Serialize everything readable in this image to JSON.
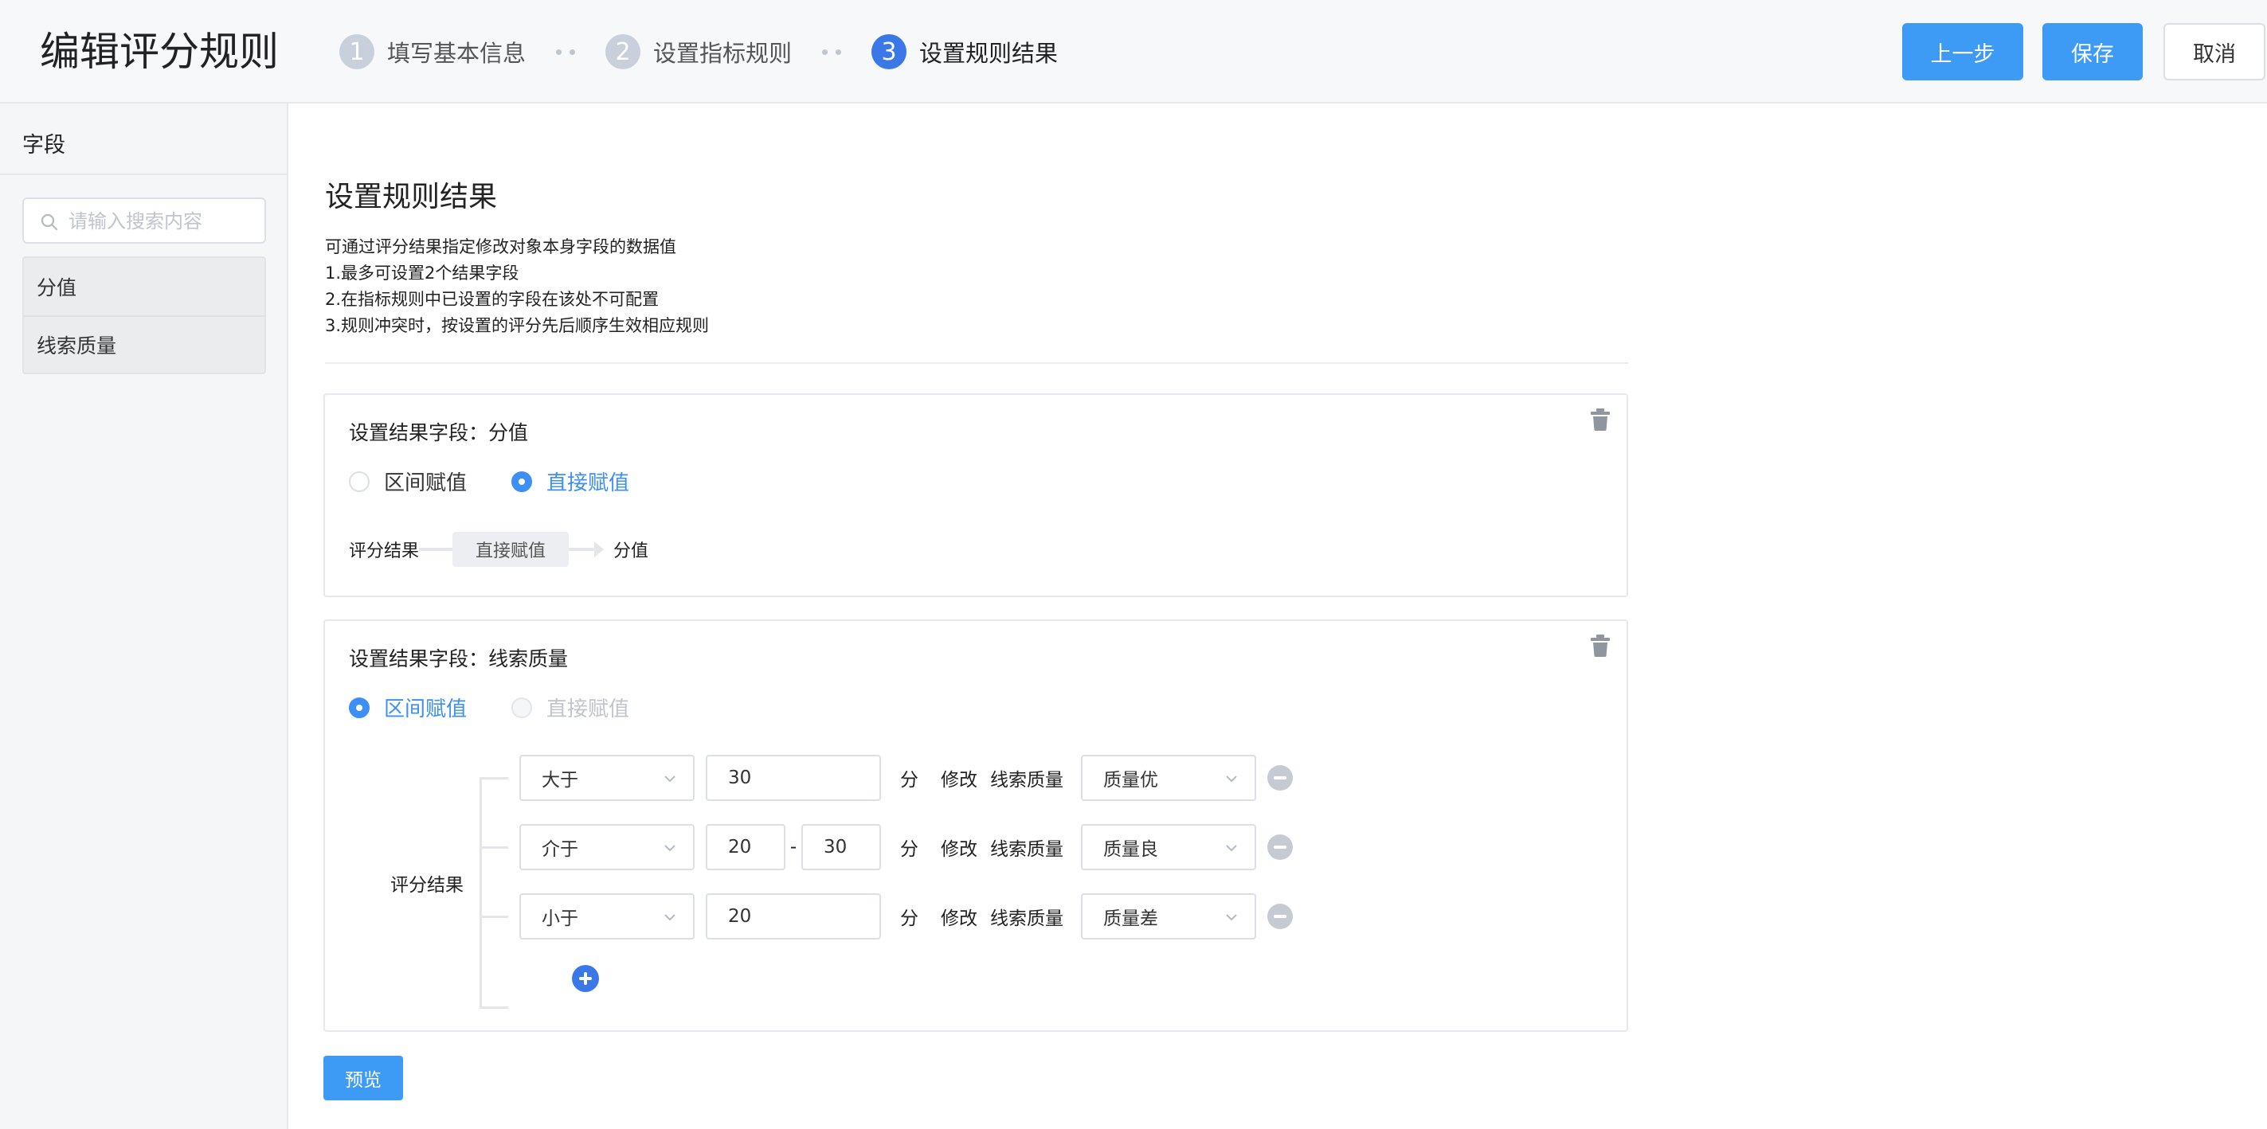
{
  "header": {
    "title": "编辑评分规则",
    "steps": [
      {
        "num": "1",
        "label": "填写基本信息"
      },
      {
        "num": "2",
        "label": "设置指标规则"
      },
      {
        "num": "3",
        "label": "设置规则结果"
      }
    ],
    "prev_label": "上一步",
    "save_label": "保存",
    "cancel_label": "取消"
  },
  "sidebar": {
    "title": "字段",
    "search_placeholder": "请输入搜索内容",
    "items": [
      {
        "label": "分值"
      },
      {
        "label": "线索质量"
      }
    ]
  },
  "main": {
    "title": "设置规则结果",
    "desc": [
      "可通过评分结果指定修改对象本身字段的数据值",
      "1.最多可设置2个结果字段",
      "2.在指标规则中已设置的字段在该处不可配置",
      "3.规则冲突时，按设置的评分先后顺序生效相应规则"
    ],
    "cards": [
      {
        "title_prefix": "设置结果字段：",
        "field": "分值",
        "radio_interval": "区间赋值",
        "radio_direct": "直接赋值",
        "flow_start": "评分结果",
        "flow_mid": "直接赋值",
        "flow_end": "分值"
      },
      {
        "title_prefix": "设置结果字段：",
        "field": "线索质量",
        "radio_interval": "区间赋值",
        "radio_direct": "直接赋值",
        "rule_label": "评分结果",
        "rules": [
          {
            "op": "大于",
            "v1": "30",
            "unit": "分",
            "action": "修改",
            "target": "线索质量",
            "result": "质量优"
          },
          {
            "op": "介于",
            "v1": "20",
            "sep": "-",
            "v2": "30",
            "unit": "分",
            "action": "修改",
            "target": "线索质量",
            "result": "质量良"
          },
          {
            "op": "小于",
            "v1": "20",
            "unit": "分",
            "action": "修改",
            "target": "线索质量",
            "result": "质量差"
          }
        ]
      }
    ],
    "preview_label": "预览"
  },
  "colors": {
    "primary": "#3d9bf5",
    "step_active": "#3b78e7",
    "radio_checked": "#3d8ef5"
  }
}
